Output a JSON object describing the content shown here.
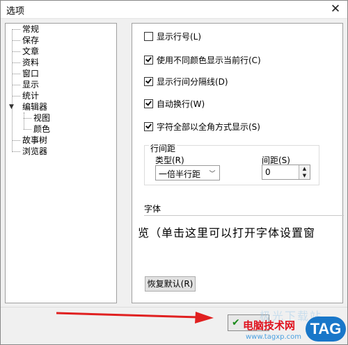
{
  "window": {
    "title": "选项",
    "close_glyph": "✕"
  },
  "tree": {
    "items": [
      {
        "label": "常规"
      },
      {
        "label": "保存"
      },
      {
        "label": "文章"
      },
      {
        "label": "资料"
      },
      {
        "label": "窗口"
      },
      {
        "label": "显示"
      },
      {
        "label": "统计"
      },
      {
        "label": "编辑器",
        "expanded": true,
        "children": [
          {
            "label": "视图",
            "selected": true
          },
          {
            "label": "颜色"
          }
        ]
      },
      {
        "label": "故事树"
      },
      {
        "label": "浏览器"
      }
    ]
  },
  "options": [
    {
      "label": "显示行号(L)",
      "checked": false
    },
    {
      "label": "使用不同颜色显示当前行(C)",
      "checked": true
    },
    {
      "label": "显示行间分隔线(D)",
      "checked": true
    },
    {
      "label": "自动换行(W)",
      "checked": true
    },
    {
      "label": "字符全部以全角方式显示(S)",
      "checked": true
    }
  ],
  "line_spacing": {
    "group_title": "行间距",
    "type_label": "类型(R)",
    "type_value": "一倍半行距",
    "spacing_label": "间距(S)",
    "spacing_value": "0"
  },
  "font": {
    "label": "字体",
    "preview_text": "览（单击这里可以打开字体设置窗"
  },
  "restore_button": "恢复默认(R)",
  "watermark": {
    "main": "电脑技术网",
    "url": "www.tagxp.com",
    "faded": "极光下载站",
    "tag": "TAG"
  },
  "colors": {
    "annotation_arrow": "#e02020",
    "watermark_red": "#e0121e",
    "tag_blue": "#1977c9"
  }
}
